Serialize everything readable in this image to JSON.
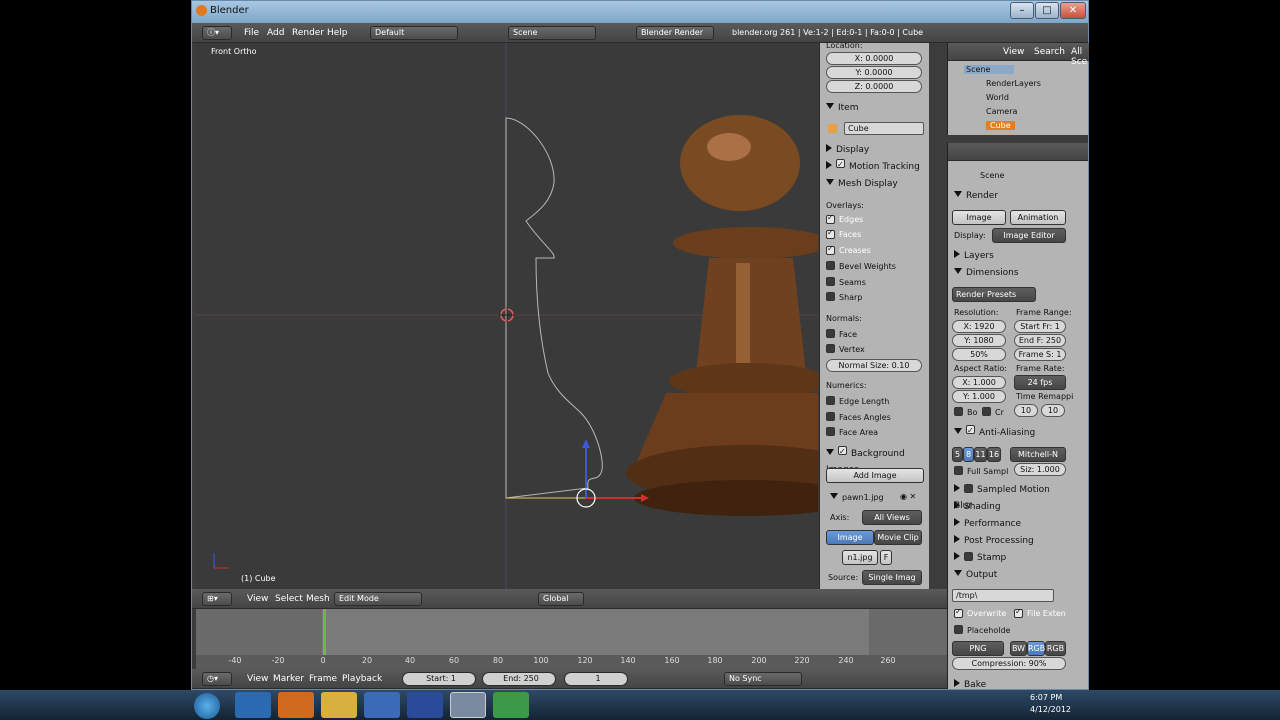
{
  "window": {
    "title": "Blender"
  },
  "top_header": {
    "menus": [
      "File",
      "Add",
      "Render",
      "Help"
    ],
    "screen_layout": "Default",
    "scene": "Scene",
    "engine": "Blender Render",
    "stats": "blender.org 261 | Ve:1-2 | Ed:0-1 | Fa:0-0 | Cube"
  },
  "viewport": {
    "view_label": "Front Ortho",
    "object_label": "(1) Cube"
  },
  "npanel": {
    "location_label": "Location:",
    "x": "X: 0.0000",
    "y": "Y: 0.0000",
    "z": "Z: 0.0000",
    "item_section": "Item",
    "object_name": "Cube",
    "display_section": "Display",
    "motion_tracking": "Motion Tracking",
    "mesh_display": "Mesh Display",
    "overlays_label": "Overlays:",
    "edges": "Edges",
    "faces": "Faces",
    "creases": "Creases",
    "bevel_weights": "Bevel Weights",
    "seams": "Seams",
    "sharp": "Sharp",
    "normals_label": "Normals:",
    "face": "Face",
    "vertex": "Vertex",
    "normal_size": "Normal Size: 0.10",
    "numerics_label": "Numerics:",
    "edge_length": "Edge Length",
    "faces_angles": "Faces Angles",
    "face_area": "Face Area",
    "background_images": "Background Images",
    "add_image": "Add Image",
    "image_name": "pawn1.jpg",
    "axis_label": "Axis:",
    "axis_value": "All Views",
    "tab_image": "Image",
    "tab_movie": "Movie Clip",
    "file_name": "n1.jpg",
    "file_flag": "F",
    "source_label": "Source:",
    "source_value": "Single Imag"
  },
  "outliner": {
    "menu": [
      "View",
      "Search",
      "All Sce"
    ],
    "items": [
      "Scene",
      "RenderLayers",
      "World",
      "Camera",
      "Cube"
    ]
  },
  "properties": {
    "context": "Scene",
    "render_section": "Render",
    "image_btn": "Image",
    "animation_btn": "Animation",
    "display_label": "Display:",
    "display_value": "Image Editor",
    "layers": "Layers",
    "dimensions": "Dimensions",
    "render_presets": "Render Presets",
    "resolution_label": "Resolution:",
    "res_x": "X: 1920",
    "res_y": "Y: 1080",
    "res_pct": "50%",
    "frame_range_label": "Frame Range:",
    "start_fr": "Start Fr: 1",
    "end_fr": "End F: 250",
    "frame_step": "Frame S: 1",
    "aspect_label": "Aspect Ratio:",
    "asp_x": "X: 1.000",
    "asp_y": "Y: 1.000",
    "frame_rate_label": "Frame Rate:",
    "fps": "24 fps",
    "time_remap": "Time Remappi",
    "remap_a": "10",
    "remap_b": "10",
    "bo": "Bo",
    "cr": "Cr",
    "anti_aliasing": "Anti-Aliasing",
    "aa_samples": [
      "5",
      "8",
      "11",
      "16"
    ],
    "filter": "Mitchell-N",
    "full_sample": "Full Sampl",
    "filter_size": "Siz: 1.000",
    "sampled_motion_blur": "Sampled Motion Blur",
    "shading": "Shading",
    "performance": "Performance",
    "post_processing": "Post Processing",
    "stamp": "Stamp",
    "output": "Output",
    "output_path": "/tmp\\",
    "overwrite": "Overwrite",
    "file_exten": "File Exten",
    "placeholde": "Placeholde",
    "format": "PNG",
    "bw": "BW",
    "rgb": "RGB",
    "rgba": "RGB",
    "compression": "Compression: 90%",
    "bake": "Bake"
  },
  "view3d_header": {
    "menus": [
      "View",
      "Select",
      "Mesh"
    ],
    "mode": "Edit Mode",
    "orientation": "Global"
  },
  "timeline": {
    "ticks": [
      "-40",
      "-20",
      "0",
      "20",
      "40",
      "60",
      "80",
      "100",
      "120",
      "140",
      "160",
      "180",
      "200",
      "220",
      "240",
      "260"
    ],
    "menus": [
      "View",
      "Marker",
      "Frame",
      "Playback"
    ],
    "start": "Start: 1",
    "end": "End: 250",
    "current": "1",
    "sync": "No Sync"
  },
  "taskbar": {
    "time": "6:07 PM",
    "date": "4/12/2012"
  }
}
